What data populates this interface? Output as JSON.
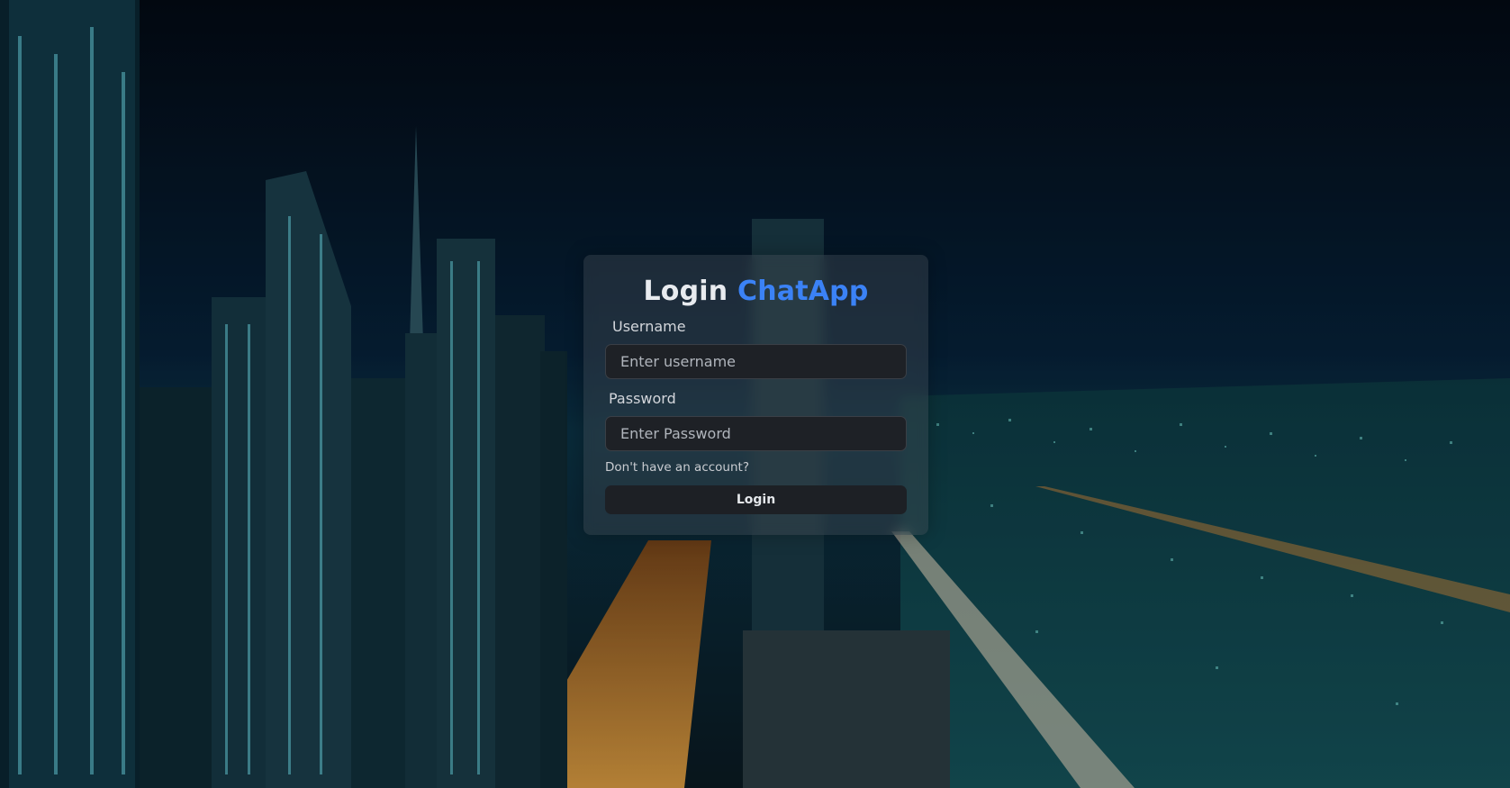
{
  "title": {
    "prefix": "Login",
    "accent": "ChatApp",
    "accent_color": "#3b82f6"
  },
  "form": {
    "username_label": "Username",
    "username_placeholder": "Enter username",
    "password_label": "Password",
    "password_placeholder": "Enter Password",
    "signup_link": "Don't have an account?",
    "submit_label": "Login"
  },
  "background": {
    "description_icon": "city-skyline-night-background"
  }
}
